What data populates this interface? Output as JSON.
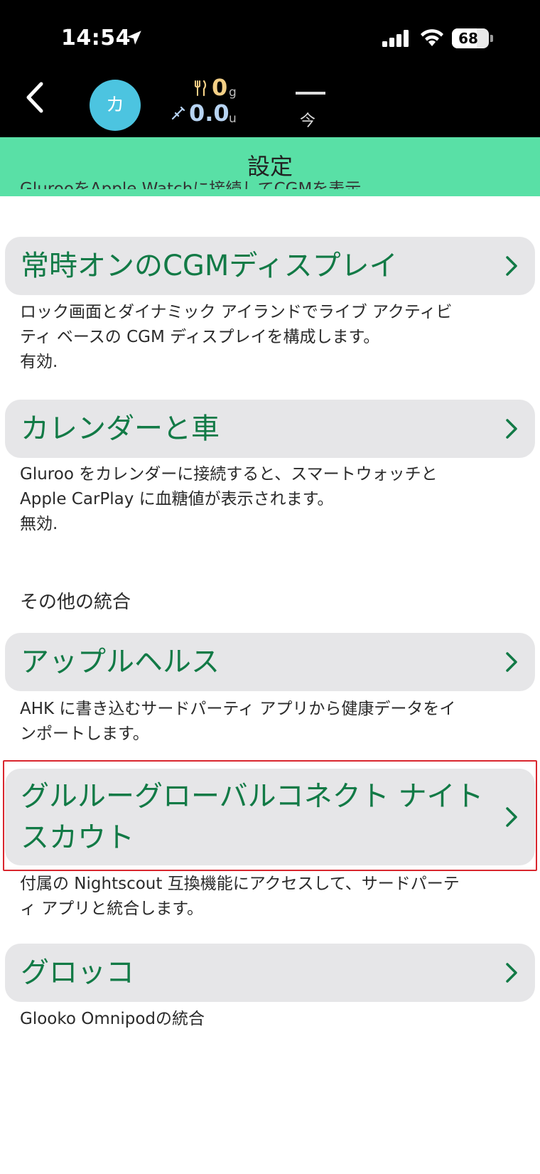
{
  "status_bar": {
    "time": "14:54",
    "battery": "68",
    "battery_level": 0.68
  },
  "top_bar": {
    "avatar_letter": "カ",
    "carbs_value": "0",
    "carbs_unit": "g",
    "insulin_value": "0.0",
    "insulin_unit": "u",
    "glucose_dash": "—",
    "now_label": "今"
  },
  "header": {
    "title": "設定"
  },
  "content": {
    "partial_text": "GlurooをApple Watchに接続してCGMを表示",
    "items": [
      {
        "title": "常時オンのCGMディスプレイ",
        "description_lines": [
          "ロック画面とダイナミック アイランドでライブ アクティビ",
          "ティ ベースの CGM ディスプレイを構成します。",
          "有効."
        ]
      },
      {
        "title": "カレンダーと車",
        "description_lines": [
          "Gluroo をカレンダーに接続すると、スマートウォッチと",
          "Apple CarPlay に血糖値が表示されます。",
          "無効."
        ]
      },
      {
        "title": "アップルヘルス",
        "description_lines": [
          "AHK に書き込むサードパーティ アプリから健康データをイ",
          "ンポートします。"
        ]
      },
      {
        "title_lines": [
          "グルルーグローバルコネクト ナイト",
          "スカウト"
        ],
        "description_lines": [
          "付属の Nightscout 互換機能にアクセスして、サードパーテ",
          "ィ アプリと統合します。"
        ]
      },
      {
        "title": "グロッコ",
        "description_lines": [
          "Glooko Omnipodの統合"
        ]
      }
    ],
    "section_label": "その他の統合"
  },
  "colors": {
    "header_bg": "#59e0a6",
    "title_green": "#127a46",
    "row_bg": "#e6e6e8",
    "highlight_red": "#d9262e",
    "avatar_bg": "#4cc4e0"
  }
}
